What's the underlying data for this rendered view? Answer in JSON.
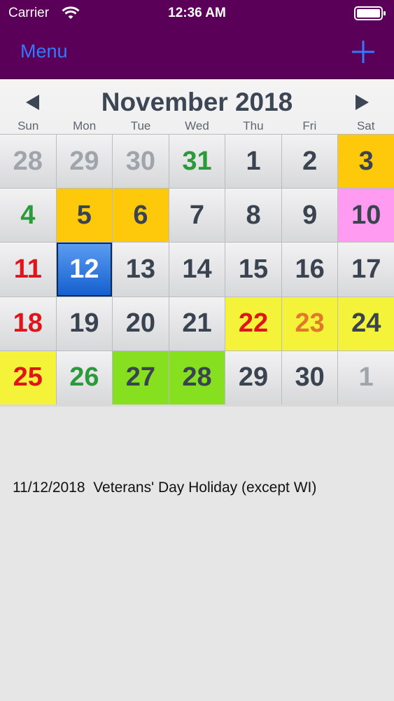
{
  "status_bar": {
    "carrier": "Carrier",
    "time": "12:36 AM"
  },
  "nav": {
    "menu_label": "Menu",
    "add_icon": "plus-icon"
  },
  "calendar": {
    "month_title": "November 2018",
    "weekdays": [
      "Sun",
      "Mon",
      "Tue",
      "Wed",
      "Thu",
      "Fri",
      "Sat"
    ],
    "days": [
      "28",
      "29",
      "30",
      "31",
      "1",
      "2",
      "3",
      "4",
      "5",
      "6",
      "7",
      "8",
      "9",
      "10",
      "11",
      "12",
      "13",
      "14",
      "15",
      "16",
      "17",
      "18",
      "19",
      "20",
      "21",
      "22",
      "23",
      "24",
      "25",
      "26",
      "27",
      "28",
      "29",
      "30",
      "1"
    ],
    "selected_day": "12",
    "colors": {
      "header_bg": "#5a0058",
      "accent_blue": "#2f7bff",
      "holiday_orange": "#ffc90b",
      "pink": "#ff9bf0",
      "yellow": "#f5f23a",
      "lime": "#86e01f",
      "red_text": "#e0151b",
      "green_text": "#2a9a3a"
    }
  },
  "event": {
    "text": "11/12/2018  Veterans' Day Holiday (except WI)"
  }
}
